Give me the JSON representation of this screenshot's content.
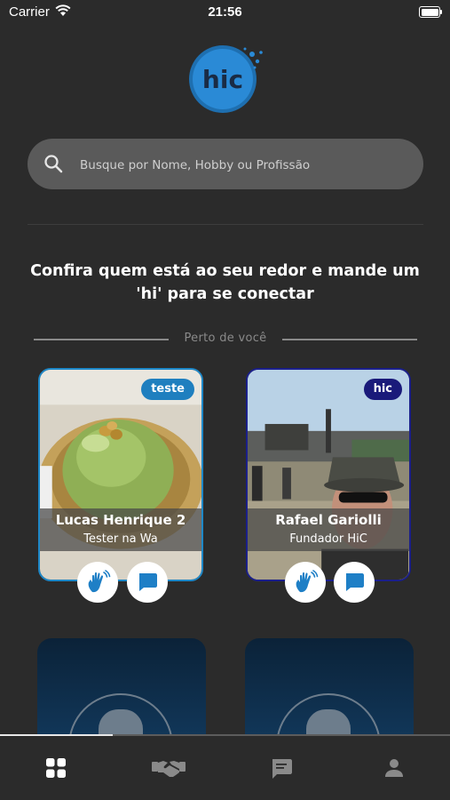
{
  "status_bar": {
    "carrier": "Carrier",
    "time": "21:56"
  },
  "logo": {
    "text": "hic"
  },
  "search": {
    "placeholder": "Busque por Nome, Hobby ou Profissão"
  },
  "headline": {
    "line1": "Confira quem está ao seu redor e mande um",
    "line2": "'hi' para se conectar"
  },
  "section": {
    "near_label": "Perto de  você"
  },
  "cards": [
    {
      "name": "Lucas Henrique 2",
      "role": "Tester na Wa",
      "tag": "teste",
      "tag_color": "#1f7fbf",
      "border_color": "#1e88c8"
    },
    {
      "name": "Rafael Gariolli",
      "role": "Fundador HiC",
      "tag": "hic",
      "tag_color": "#1a1a7a",
      "border_color": "#1b1f8a"
    }
  ],
  "tabs": [
    {
      "icon": "grid-icon",
      "active": true
    },
    {
      "icon": "handshake-icon",
      "active": false
    },
    {
      "icon": "chat-icon",
      "active": false
    },
    {
      "icon": "person-icon",
      "active": false
    }
  ],
  "colors": {
    "background": "#2b2b2b",
    "accent": "#1e88c8",
    "search_bg": "#5a5a5a"
  }
}
